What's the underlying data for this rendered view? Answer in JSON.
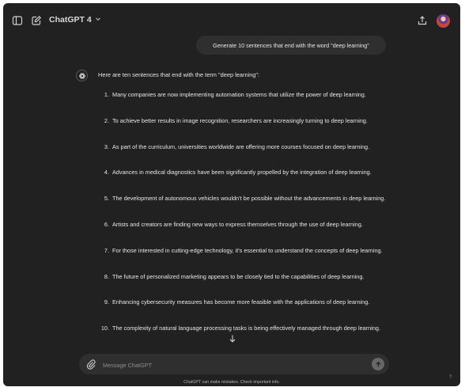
{
  "header": {
    "model_label": "ChatGPT 4"
  },
  "conversation": {
    "user_message": "Generate 10 sentences that end with the word \"deep learning\"",
    "assistant_intro": "Here are ten sentences that end with the term \"deep learning\":",
    "items": [
      {
        "num": "1.",
        "text": "Many companies are now implementing automation systems that utilize the power of deep learning."
      },
      {
        "num": "2.",
        "text": "To achieve better results in image recognition, researchers are increasingly turning to deep learning."
      },
      {
        "num": "3.",
        "text": "As part of the curriculum, universities worldwide are offering more courses focused on deep learning."
      },
      {
        "num": "4.",
        "text": "Advances in medical diagnostics have been significantly propelled by the integration of deep learning."
      },
      {
        "num": "5.",
        "text": "The development of autonomous vehicles wouldn't be possible without the advancements in deep learning."
      },
      {
        "num": "6.",
        "text": "Artists and creators are finding new ways to express themselves through the use of deep learning."
      },
      {
        "num": "7.",
        "text": "For those interested in cutting-edge technology, it's essential to understand the concepts of deep learning."
      },
      {
        "num": "8.",
        "text": "The future of personalized marketing appears to be closely tied to the capabilities of deep learning."
      },
      {
        "num": "9.",
        "text": "Enhancing cybersecurity measures has become more feasible with the applications of deep learning."
      },
      {
        "num": "10.",
        "text": "The complexity of natural language processing tasks is being effectively managed through deep learning."
      }
    ]
  },
  "composer": {
    "placeholder": "Message ChatGPT",
    "value": ""
  },
  "footer": {
    "disclaimer": "ChatGPT can make mistakes. Check important info.",
    "help": "?"
  },
  "colors": {
    "background": "#212121",
    "bubble": "#2f2f2f",
    "text": "#ececec"
  }
}
